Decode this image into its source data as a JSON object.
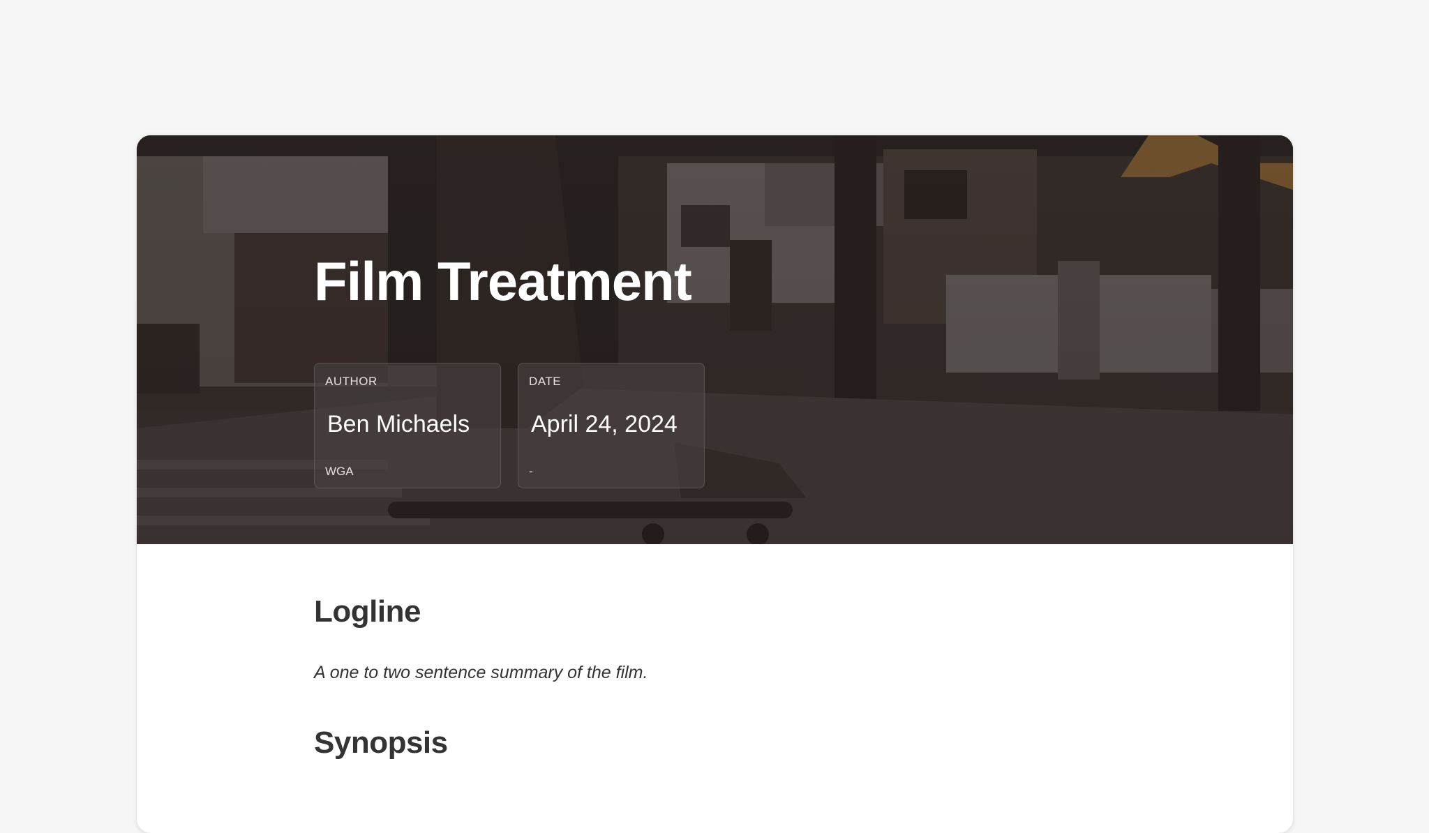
{
  "document": {
    "title": "Film Treatment"
  },
  "meta": {
    "author": {
      "label": "AUTHOR",
      "value": "Ben Michaels",
      "sub": "WGA"
    },
    "date": {
      "label": "DATE",
      "value": "April 24, 2024",
      "sub": "-"
    }
  },
  "sections": {
    "logline": {
      "heading": "Logline",
      "body": "A one to two sentence summary of the film."
    },
    "synopsis": {
      "heading": "Synopsis"
    }
  },
  "colors": {
    "background": "#f6f6f6",
    "card": "#ffffff",
    "heading_text": "#333333",
    "hero_text": "#ffffff"
  }
}
